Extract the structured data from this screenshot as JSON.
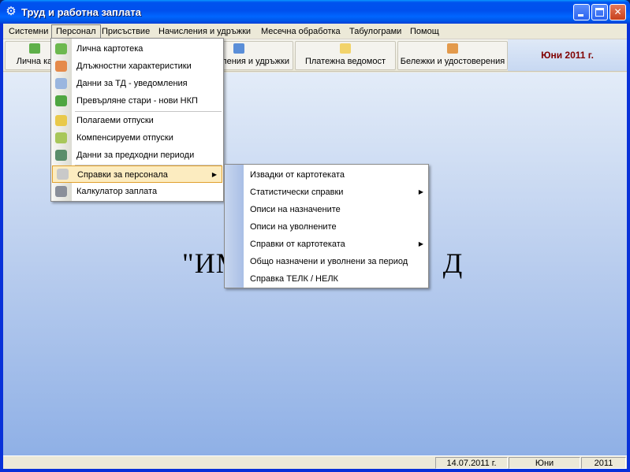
{
  "window": {
    "title": "Труд и работна заплата",
    "app_icon": "gear-icon"
  },
  "menubar": {
    "items": [
      "Системни",
      "Персонал",
      "Присъствие",
      "Начисления и удръжки",
      "Месечна обработка",
      "Табулограми",
      "Помощ"
    ],
    "active": "Персонал"
  },
  "toolbar": {
    "buttons": [
      {
        "label": "Лична ка",
        "icon": "person-icon"
      },
      {
        "label": "ления и удръжки",
        "icon": "calculator-icon"
      },
      {
        "label": "Платежна ведомост",
        "icon": "document-icon"
      },
      {
        "label": "Бележки и удостоверения",
        "icon": "certificate-icon"
      }
    ],
    "period": "Юни 2011 г."
  },
  "main": {
    "company_visible_text": "\"ИМ",
    "company_visible_text_end": "Д"
  },
  "personnel_menu": {
    "items": [
      {
        "label": "Лична картотека",
        "icon": "person-card-icon"
      },
      {
        "label": "Длъжностни характеристики",
        "icon": "person-role-icon"
      },
      {
        "label": "Данни за ТД - уведомления",
        "icon": "notification-icon"
      },
      {
        "label": "Превърляне стари - нови НКП",
        "icon": "transfer-icon"
      },
      {
        "label": "Полагаеми отпуски",
        "icon": "leave-icon"
      },
      {
        "label": "Компенсируеми отпуски",
        "icon": "compensation-icon"
      },
      {
        "label": "Данни за предходни периоди",
        "icon": "history-icon"
      },
      {
        "label": "Справки за персонала",
        "icon": "report-icon",
        "submenu": true,
        "highlighted": true
      },
      {
        "label": "Калкулатор заплата",
        "icon": "calculator-icon"
      }
    ]
  },
  "reports_submenu": {
    "items": [
      {
        "label": "Извадки от картотеката"
      },
      {
        "label": "Статистически справки",
        "submenu": true
      },
      {
        "label": "Описи на назначените"
      },
      {
        "label": "Описи на уволнените"
      },
      {
        "label": "Справки от картотеката",
        "submenu": true
      },
      {
        "label": "Общо назначени и уволнени за период"
      },
      {
        "label": "Справка ТЕЛК / НЕЛК"
      }
    ]
  },
  "statusbar": {
    "date": "14.07.2011 г.",
    "month": "Юни",
    "year": "2011"
  },
  "colors": {
    "titlebar": "#0053ee",
    "period_text": "#800000",
    "highlight_bg": "#fcecc0",
    "highlight_border": "#e0a02e"
  }
}
